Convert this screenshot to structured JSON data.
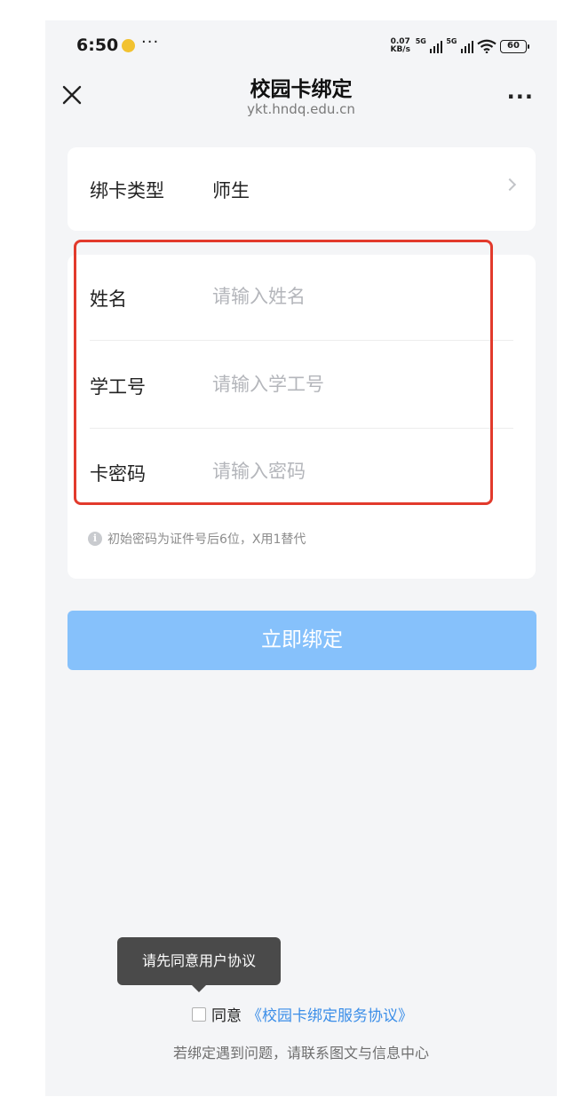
{
  "status_bar": {
    "time": "6:50",
    "dots": "···",
    "speed_value": "0.07",
    "speed_unit": "KB/s",
    "net1": "5G",
    "net2": "5G",
    "battery": "60",
    "icons": [
      "app-notification-icon",
      "signal-icon",
      "wifi-icon",
      "battery-icon"
    ]
  },
  "navbar": {
    "title": "校园卡绑定",
    "url": "ykt.hndq.edu.cn",
    "more": "···",
    "close_icon": "close-icon"
  },
  "bind_type": {
    "label": "绑卡类型",
    "value": "师生",
    "icon": "chevron-right-icon"
  },
  "form": {
    "name": {
      "label": "姓名",
      "placeholder": "请输入姓名",
      "value": ""
    },
    "student_id": {
      "label": "学工号",
      "placeholder": "请输入学工号",
      "value": ""
    },
    "card_password": {
      "label": "卡密码",
      "placeholder": "请输入密码",
      "value": ""
    },
    "hint": "初始密码为证件号后6位，X用1替代",
    "hint_icon": "info-icon"
  },
  "bind_button": "立即绑定",
  "tooltip": "请先同意用户协议",
  "agreement": {
    "text": "同意",
    "link": "《校园卡绑定服务协议》",
    "checked": false
  },
  "help_text": "若绑定遇到问题，请联系图文与信息中心",
  "colors": {
    "accent_button": "#86c1fb",
    "link": "#3b8ee8",
    "highlight_border": "#e23a2c",
    "background": "#f4f5f7"
  }
}
